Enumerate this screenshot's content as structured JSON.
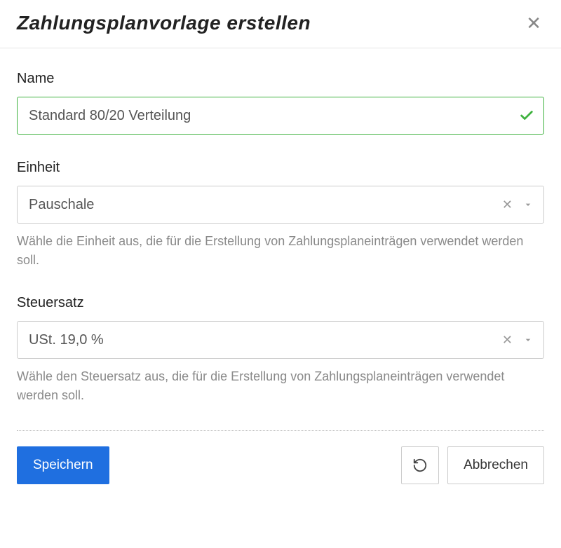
{
  "header": {
    "title": "Zahlungsplanvorlage erstellen"
  },
  "form": {
    "name": {
      "label": "Name",
      "value": "Standard 80/20 Verteilung"
    },
    "unit": {
      "label": "Einheit",
      "value": "Pauschale",
      "help": "Wähle die Einheit aus, die für die Erstellung von Zahlungsplaneinträgen verwendet werden soll."
    },
    "tax": {
      "label": "Steuersatz",
      "value": "USt. 19,0 %",
      "help": "Wähle den Steuersatz aus, die für die Erstellung von Zahlungsplaneinträgen verwendet werden soll."
    }
  },
  "footer": {
    "save": "Speichern",
    "cancel": "Abbrechen"
  }
}
